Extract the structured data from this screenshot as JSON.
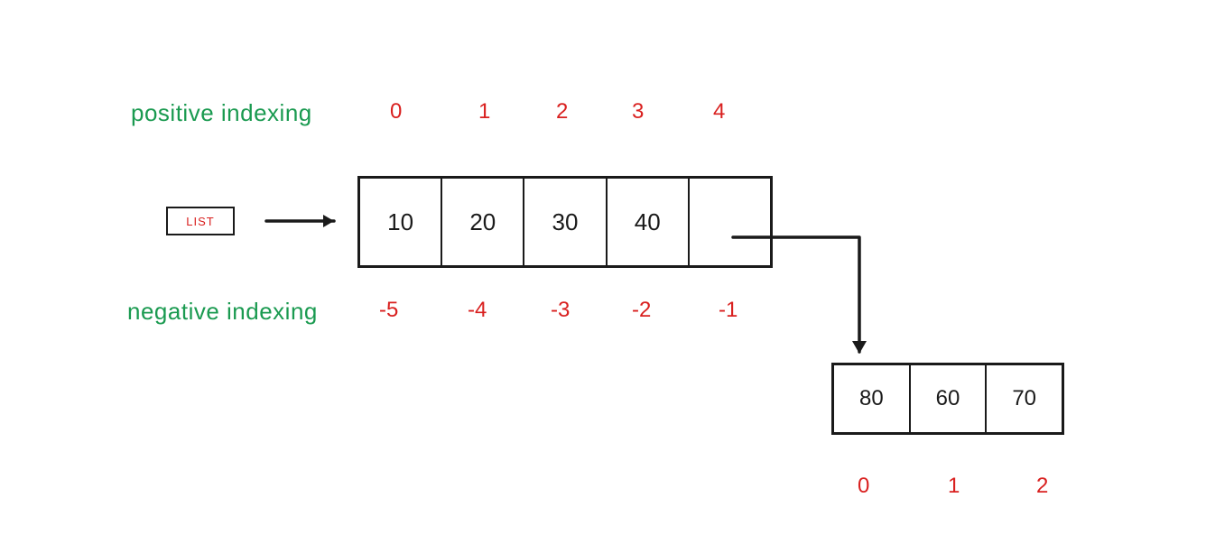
{
  "labels": {
    "positive": "positive indexing",
    "negative": "negative indexing",
    "list": "LIST"
  },
  "main_list": {
    "values": [
      "10",
      "20",
      "30",
      "40",
      ""
    ],
    "positive_index": [
      "0",
      "1",
      "2",
      "3",
      "4"
    ],
    "negative_index": [
      "-5",
      "-4",
      "-3",
      "-2",
      "-1"
    ]
  },
  "sub_list": {
    "values": [
      "80",
      "60",
      "70"
    ],
    "index": [
      "0",
      "1",
      "2"
    ]
  }
}
